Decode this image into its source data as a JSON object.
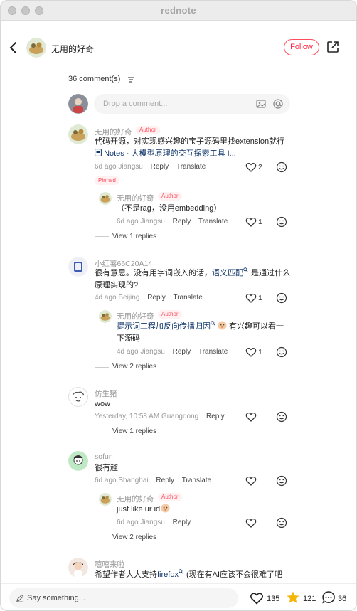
{
  "window": {
    "title": "rednote"
  },
  "header": {
    "author_name": "无用的好奇",
    "follow_label": "Follow"
  },
  "comments_header": {
    "count_label": "36 comment(s)"
  },
  "composer": {
    "placeholder": "Drop a comment..."
  },
  "comments": [
    {
      "name": "无用的好奇",
      "tag": "Author",
      "text": "代码开源，对实现感兴趣的宝子源码里找extension就行",
      "link_text": "Notes · 大模型原理的交互探索工具 I...",
      "time": "6d ago",
      "location": "Jiangsu",
      "reply": "Reply",
      "translate": "Translate",
      "likes": "2",
      "pinned": "Pinned",
      "replies": [
        {
          "name": "无用的好奇",
          "tag": "Author",
          "text": "（不是rag，没用embedding）",
          "time": "6d ago",
          "location": "Jiangsu",
          "reply": "Reply",
          "translate": "Translate",
          "likes": "1"
        }
      ],
      "view_replies": "View 1 replies"
    },
    {
      "name": "小红薯66C20A14",
      "text_a": "很有意思。没有用字词嵌入的话，",
      "text_link": "语义匹配",
      "text_b": "是通过什么原理实现的?",
      "time": "4d ago",
      "location": "Beijing",
      "reply": "Reply",
      "translate": "Translate",
      "likes": "1",
      "replies": [
        {
          "name": "无用的好奇",
          "tag": "Author",
          "text_link": "提示词工程加反向传播归因",
          "text_b": "有兴趣可以看一下源码",
          "time": "4d ago",
          "location": "Jiangsu",
          "reply": "Reply",
          "translate": "Translate",
          "likes": "1"
        }
      ],
      "view_replies": "View 2 replies"
    },
    {
      "name": "仿生猪",
      "text": "wow",
      "time": "Yesterday, 10:58 AM",
      "location": "Guangdong",
      "reply": "Reply",
      "view_replies": "View 1 replies"
    },
    {
      "name": "sofun",
      "text": "很有趣",
      "time": "6d ago",
      "location": "Shanghai",
      "reply": "Reply",
      "translate": "Translate",
      "replies": [
        {
          "name": "无用的好奇",
          "tag": "Author",
          "text": "just like ur id",
          "time": "6d ago",
          "location": "Jiangsu",
          "reply": "Reply"
        }
      ],
      "view_replies": "View 2 replies"
    },
    {
      "name": "嘻嘻来啦",
      "text_a": "希望作者大大支持",
      "text_link": "firefox",
      "text_b": "(现在有AI应该不会很难了吧"
    }
  ],
  "bottom": {
    "say_placeholder": "Say something...",
    "likes": "135",
    "stars": "121",
    "comments": "36"
  },
  "colors": {
    "accent": "#ff2442",
    "link": "#13386c",
    "star": "#f5b60a"
  }
}
